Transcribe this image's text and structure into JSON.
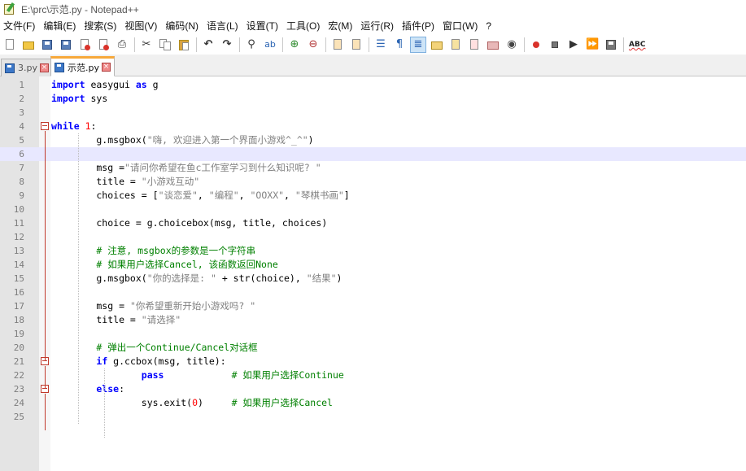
{
  "window": {
    "title": "E:\\prc\\示范.py - Notepad++"
  },
  "menu": [
    "文件(F)",
    "编辑(E)",
    "搜索(S)",
    "视图(V)",
    "编码(N)",
    "语言(L)",
    "设置(T)",
    "工具(O)",
    "宏(M)",
    "运行(R)",
    "插件(P)",
    "窗口(W)",
    "?"
  ],
  "toolbar": {
    "spell_label": "ABC"
  },
  "tabs": [
    {
      "label": "3.py",
      "active": false
    },
    {
      "label": "示范.py",
      "active": true
    }
  ],
  "editor": {
    "current_line": 6,
    "lines": [
      {
        "n": "1",
        "tokens": [
          [
            "kw",
            "import"
          ],
          [
            "t",
            " easygui "
          ],
          [
            "kw",
            "as"
          ],
          [
            "t",
            " g"
          ]
        ]
      },
      {
        "n": "2",
        "tokens": [
          [
            "kw",
            "import"
          ],
          [
            "t",
            " sys"
          ]
        ]
      },
      {
        "n": "3",
        "tokens": []
      },
      {
        "n": "4",
        "tokens": [
          [
            "kw",
            "while"
          ],
          [
            "t",
            " "
          ],
          [
            "num",
            "1"
          ],
          [
            "t",
            ":"
          ]
        ]
      },
      {
        "n": "5",
        "tokens": [
          [
            "t",
            "        g.msgbox("
          ],
          [
            "str",
            "\"嗨, 欢迎进入第一个界面小游戏^_^\""
          ],
          [
            "t",
            ")"
          ]
        ]
      },
      {
        "n": "6",
        "tokens": []
      },
      {
        "n": "7",
        "tokens": [
          [
            "t",
            "        msg ="
          ],
          [
            "str",
            "\"请问你希望在鱼c工作室学习到什么知识呢? \""
          ]
        ]
      },
      {
        "n": "8",
        "tokens": [
          [
            "t",
            "        title = "
          ],
          [
            "str",
            "\"小游戏互动\""
          ]
        ]
      },
      {
        "n": "9",
        "tokens": [
          [
            "t",
            "        choices = ["
          ],
          [
            "str",
            "\"谈恋爱\""
          ],
          [
            "t",
            ", "
          ],
          [
            "str",
            "\"编程\""
          ],
          [
            "t",
            ", "
          ],
          [
            "str",
            "\"OOXX\""
          ],
          [
            "t",
            ", "
          ],
          [
            "str",
            "\"琴棋书画\""
          ],
          [
            "t",
            "]"
          ]
        ]
      },
      {
        "n": "10",
        "tokens": []
      },
      {
        "n": "11",
        "tokens": [
          [
            "t",
            "        choice = g.choicebox(msg, title, choices)"
          ]
        ]
      },
      {
        "n": "12",
        "tokens": []
      },
      {
        "n": "13",
        "tokens": [
          [
            "cmt",
            "        # 注意, msgbox的参数是一个字符串"
          ]
        ]
      },
      {
        "n": "14",
        "tokens": [
          [
            "cmt",
            "        # 如果用户选择Cancel, 该函数返回None"
          ]
        ]
      },
      {
        "n": "15",
        "tokens": [
          [
            "t",
            "        g.msgbox("
          ],
          [
            "str",
            "\"你的选择是: \""
          ],
          [
            "t",
            " + str(choice), "
          ],
          [
            "str",
            "\"结果\""
          ],
          [
            "t",
            ")"
          ]
        ]
      },
      {
        "n": "16",
        "tokens": []
      },
      {
        "n": "17",
        "tokens": [
          [
            "t",
            "        msg = "
          ],
          [
            "str",
            "\"你希望重新开始小游戏吗? \""
          ]
        ]
      },
      {
        "n": "18",
        "tokens": [
          [
            "t",
            "        title = "
          ],
          [
            "str",
            "\"请选择\""
          ]
        ]
      },
      {
        "n": "19",
        "tokens": []
      },
      {
        "n": "20",
        "tokens": [
          [
            "cmt",
            "        # 弹出一个Continue/Cancel对话框"
          ]
        ]
      },
      {
        "n": "21",
        "tokens": [
          [
            "t",
            "        "
          ],
          [
            "kw",
            "if"
          ],
          [
            "t",
            " g.ccbox(msg, title):"
          ]
        ]
      },
      {
        "n": "22",
        "tokens": [
          [
            "t",
            "                "
          ],
          [
            "kw",
            "pass"
          ],
          [
            "t",
            "            "
          ],
          [
            "cmt",
            "# 如果用户选择Continue"
          ]
        ]
      },
      {
        "n": "23",
        "tokens": [
          [
            "t",
            "        "
          ],
          [
            "kw",
            "else"
          ],
          [
            "t",
            ":"
          ]
        ]
      },
      {
        "n": "24",
        "tokens": [
          [
            "t",
            "                sys.exit("
          ],
          [
            "num",
            "0"
          ],
          [
            "t",
            ")     "
          ],
          [
            "cmt",
            "# 如果用户选择Cancel"
          ]
        ]
      },
      {
        "n": "25",
        "tokens": []
      }
    ]
  },
  "colors": {
    "keyword": "#0000ff",
    "string": "#808080",
    "number": "#ff0000",
    "comment": "#008000",
    "current_line": "#e8e8ff",
    "active_tab_accent": "#f7a83a"
  }
}
